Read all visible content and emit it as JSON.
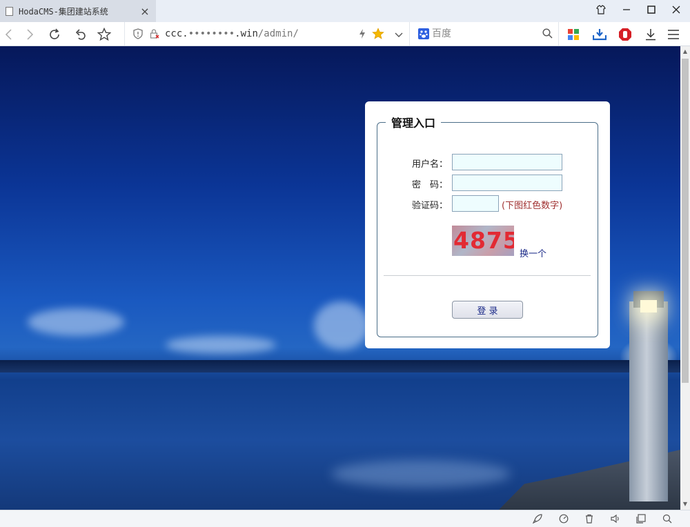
{
  "browser": {
    "tab_title": "HodaCMS-集团建站系统",
    "address_main": "ccc.",
    "address_blurred": "••••••••",
    "address_domain": ".win",
    "address_path": "/admin/",
    "search_placeholder": "百度"
  },
  "login": {
    "legend": "管理入口",
    "username_label": "用户名：",
    "password_label": "密　码：",
    "captcha_label": "验证码：",
    "captcha_hint": "(下图红色数字)",
    "captcha_image_text": "4875",
    "refresh_link": "换一个",
    "submit_label": "登 录",
    "username_value": "",
    "password_value": "",
    "captcha_value": ""
  },
  "colors": {
    "field_bg": "#eefdfe",
    "hint_red": "#a03030",
    "link_blue": "#1b2a88"
  }
}
